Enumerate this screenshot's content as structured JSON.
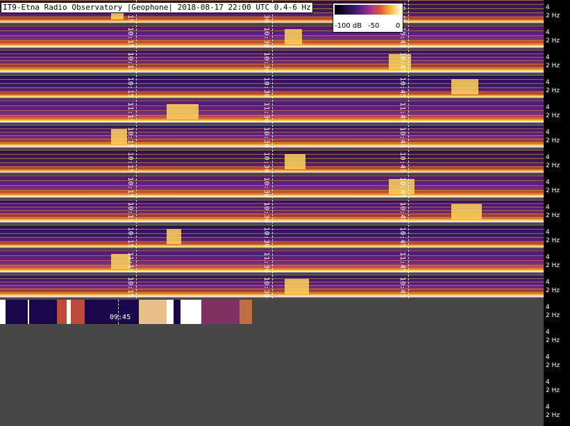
{
  "header": {
    "title": "IT9-Etna Radio Observatory |Geophone| 2018-08-17 22:00 UTC 0.4-6 Hz"
  },
  "legend": {
    "min_label": "-100 dB",
    "mid_label": "-50",
    "max_label": "0"
  },
  "scale": {
    "top_label": "4",
    "bottom_label": "2 Hz"
  },
  "rows": [
    {
      "times": [
        "10:15",
        "10:30",
        "10:45"
      ]
    },
    {
      "times": [
        "10:15",
        "10:30",
        "10:45"
      ]
    },
    {
      "times": [
        "10:15",
        "10:30",
        "10:45"
      ]
    },
    {
      "times": [
        "10:15",
        "10:30",
        "10:45"
      ]
    },
    {
      "times": [
        "11:15",
        "11:30",
        "11:45"
      ]
    },
    {
      "times": [
        "10:15",
        "10:30",
        "10:45"
      ]
    },
    {
      "times": [
        "10:15",
        "10:30",
        "10:45"
      ]
    },
    {
      "times": [
        "10:15",
        "10:30",
        "10:45"
      ]
    },
    {
      "times": [
        "10:15",
        "10:30",
        "10:45"
      ]
    },
    {
      "times": [
        "10:15",
        "10:30",
        "10:45"
      ]
    },
    {
      "times": [
        "11:15",
        "11:30",
        "11:45"
      ]
    },
    {
      "times": [
        "10:15",
        "10:30",
        "10:45"
      ]
    }
  ],
  "partial_row": {
    "times": [
      "09:45"
    ]
  }
}
